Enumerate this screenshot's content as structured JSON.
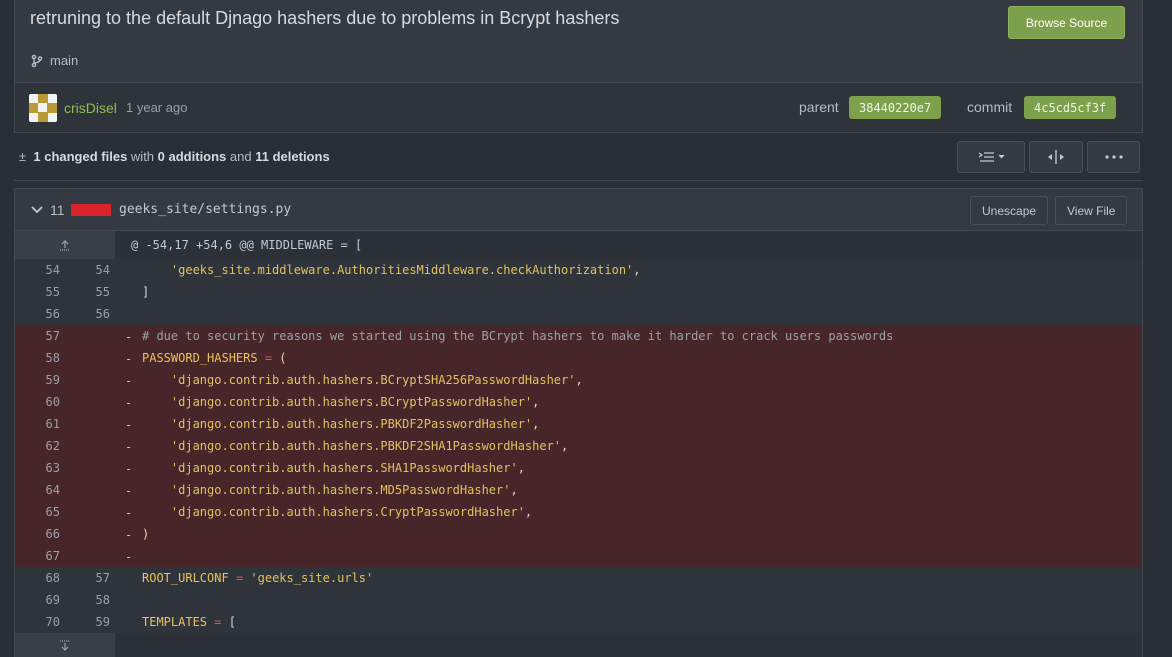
{
  "commit": {
    "title": "retruning to the default Djnago hashers due to problems in Bcrypt hashers",
    "browse_label": "Browse Source",
    "branch": "main",
    "author": "crisDisel",
    "time": "1 year ago",
    "parent_label": "parent",
    "parent_hash": "38440220e7",
    "commit_label": "commit",
    "commit_hash": "4c5cd5cf3f"
  },
  "summary": {
    "plusminus": "±",
    "changed": "1 changed files",
    "with": "with",
    "additions": "0 additions",
    "and": "and",
    "deletions": "11 deletions"
  },
  "file": {
    "del_count": "11",
    "path": "geeks_site/settings.py",
    "unescape_label": "Unescape",
    "view_label": "View File",
    "hunk_header": "@ -54,17 +54,6 @@ MIDDLEWARE = ["
  },
  "icons": {
    "branch": "branch-icon",
    "expand_up": "expand-up-icon",
    "expand_down": "expand-down-icon",
    "list_view": "list-view-icon",
    "split_view": "split-view-icon",
    "more": "more-icon",
    "chevron": "chevron-down-icon"
  },
  "colors": {
    "accent_green": "#7da04c",
    "deletion_red": "#d8242b",
    "deleted_row": "#47262a"
  },
  "lines": [
    {
      "old": "54",
      "new": "54",
      "sign": "",
      "type": "ctx",
      "text": "    'geeks_site.middleware.AuthoritiesMiddleware.checkAuthorization',"
    },
    {
      "old": "55",
      "new": "55",
      "sign": "",
      "type": "ctx",
      "text": "]"
    },
    {
      "old": "56",
      "new": "56",
      "sign": "",
      "type": "ctx",
      "text": ""
    },
    {
      "old": "57",
      "new": "",
      "sign": "-",
      "type": "del",
      "text": "# due to security reasons we started using the BCrypt hashers to make it harder to crack users passwords"
    },
    {
      "old": "58",
      "new": "",
      "sign": "-",
      "type": "del",
      "text": "PASSWORD_HASHERS = ("
    },
    {
      "old": "59",
      "new": "",
      "sign": "-",
      "type": "del",
      "text": "    'django.contrib.auth.hashers.BCryptSHA256PasswordHasher',"
    },
    {
      "old": "60",
      "new": "",
      "sign": "-",
      "type": "del",
      "text": "    'django.contrib.auth.hashers.BCryptPasswordHasher',"
    },
    {
      "old": "61",
      "new": "",
      "sign": "-",
      "type": "del",
      "text": "    'django.contrib.auth.hashers.PBKDF2PasswordHasher',"
    },
    {
      "old": "62",
      "new": "",
      "sign": "-",
      "type": "del",
      "text": "    'django.contrib.auth.hashers.PBKDF2SHA1PasswordHasher',"
    },
    {
      "old": "63",
      "new": "",
      "sign": "-",
      "type": "del",
      "text": "    'django.contrib.auth.hashers.SHA1PasswordHasher',"
    },
    {
      "old": "64",
      "new": "",
      "sign": "-",
      "type": "del",
      "text": "    'django.contrib.auth.hashers.MD5PasswordHasher',"
    },
    {
      "old": "65",
      "new": "",
      "sign": "-",
      "type": "del",
      "text": "    'django.contrib.auth.hashers.CryptPasswordHasher',"
    },
    {
      "old": "66",
      "new": "",
      "sign": "-",
      "type": "del",
      "text": ")"
    },
    {
      "old": "67",
      "new": "",
      "sign": "-",
      "type": "del",
      "text": ""
    },
    {
      "old": "68",
      "new": "57",
      "sign": "",
      "type": "ctx",
      "text": "ROOT_URLCONF = 'geeks_site.urls'"
    },
    {
      "old": "69",
      "new": "58",
      "sign": "",
      "type": "ctx",
      "text": ""
    },
    {
      "old": "70",
      "new": "59",
      "sign": "",
      "type": "ctx",
      "text": "TEMPLATES = ["
    }
  ]
}
